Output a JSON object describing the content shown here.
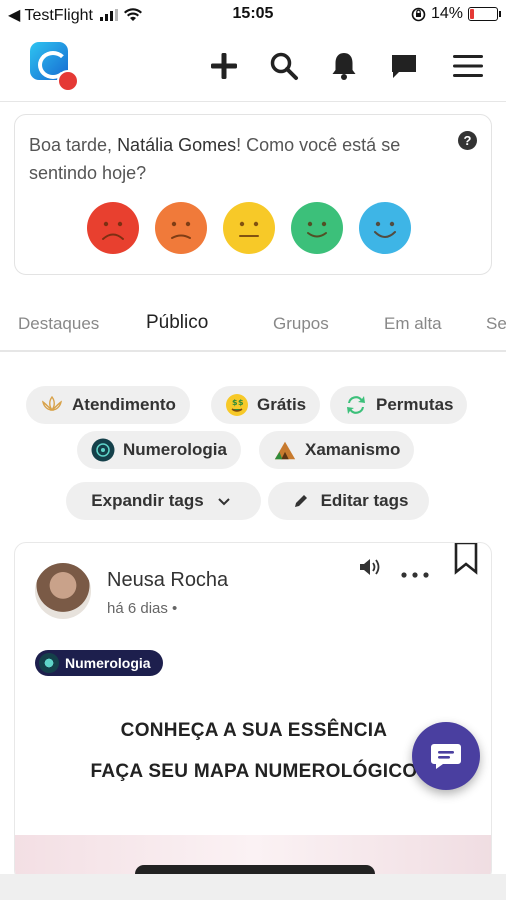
{
  "status_bar": {
    "carrier": "◀ TestFlight",
    "time": "15:05",
    "battery": "14%",
    "battery_level": 0.14
  },
  "header": {
    "logo": "app-logo",
    "icons": [
      "plus-icon",
      "search-icon",
      "bell-icon",
      "chat-icon",
      "menu-icon"
    ]
  },
  "mood": {
    "greeting_prefix": "Boa tarde, ",
    "user_name": "Natália Gomes",
    "greeting_suffix": "! Como você está se sentindo hoje?",
    "help": "?",
    "faces": [
      {
        "name": "very-sad",
        "color": "#e8402f"
      },
      {
        "name": "sad",
        "color": "#f07a3a"
      },
      {
        "name": "neutral",
        "color": "#f7c928"
      },
      {
        "name": "happy",
        "color": "#3cc07a"
      },
      {
        "name": "very-happy",
        "color": "#3eb5e6"
      }
    ]
  },
  "tabs": {
    "items": [
      "Destaques",
      "Público",
      "Grupos",
      "Em alta",
      "Se"
    ],
    "active": "Público"
  },
  "tags": {
    "chips": [
      "Atendimento",
      "Grátis",
      "Permutas",
      "Numerologia",
      "Xamanismo"
    ],
    "expand_label": "Expandir tags",
    "edit_label": "Editar tags"
  },
  "post": {
    "author": "Neusa Rocha",
    "time": "há 6 dias •",
    "tag": "Numerologia",
    "line1": "CONHEÇA A SUA ESSÊNCIA",
    "line2": "FAÇA SEU MAPA NUMEROLÓGICO"
  }
}
